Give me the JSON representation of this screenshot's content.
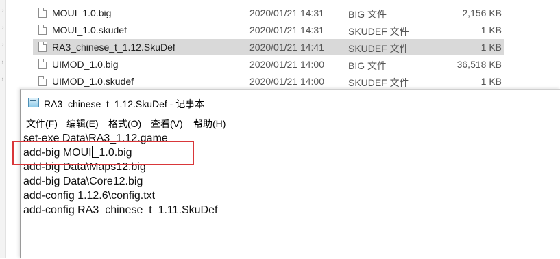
{
  "explorer": {
    "files": [
      {
        "name": "MOUI_1.0.big",
        "date": "2020/01/21 14:31",
        "type": "BIG 文件",
        "size": "2,156 KB",
        "selected": false
      },
      {
        "name": "MOUI_1.0.skudef",
        "date": "2020/01/21 14:31",
        "type": "SKUDEF 文件",
        "size": "1 KB",
        "selected": false
      },
      {
        "name": "RA3_chinese_t_1.12.SkuDef",
        "date": "2020/01/21 14:41",
        "type": "SKUDEF 文件",
        "size": "1 KB",
        "selected": true
      },
      {
        "name": "UIMOD_1.0.big",
        "date": "2020/01/21 14:00",
        "type": "BIG 文件",
        "size": "36,518 KB",
        "selected": false
      },
      {
        "name": "UIMOD_1.0.skudef",
        "date": "2020/01/21 14:00",
        "type": "SKUDEF 文件",
        "size": "1 KB",
        "selected": false
      }
    ],
    "file_icon": "document-icon",
    "gutter_icon": "chevron-right-icon"
  },
  "notepad": {
    "title": "RA3_chinese_t_1.12.SkuDef - 记事本",
    "app_icon": "notepad-icon",
    "menu": [
      "文件(F)",
      "编辑(E)",
      "格式(O)",
      "查看(V)",
      "帮助(H)"
    ],
    "lines": [
      "set-exe Data\\RA3_1.12.game",
      "add-big MOUI_1.0.big",
      "add-big Data\\Maps12.big",
      "add-big Data\\Core12.big",
      "add-config 1.12.6\\config.txt",
      "add-config RA3_chinese_t_1.11.SkuDef"
    ],
    "caret_line": 1,
    "caret_after": "add-big MOUI",
    "caret_rest": "_1.0.big"
  },
  "annotation": {
    "color": "#d9373a"
  },
  "colors": {
    "selection": "#d9d9d9",
    "text": "#1e1e1e",
    "muted": "#555555"
  }
}
